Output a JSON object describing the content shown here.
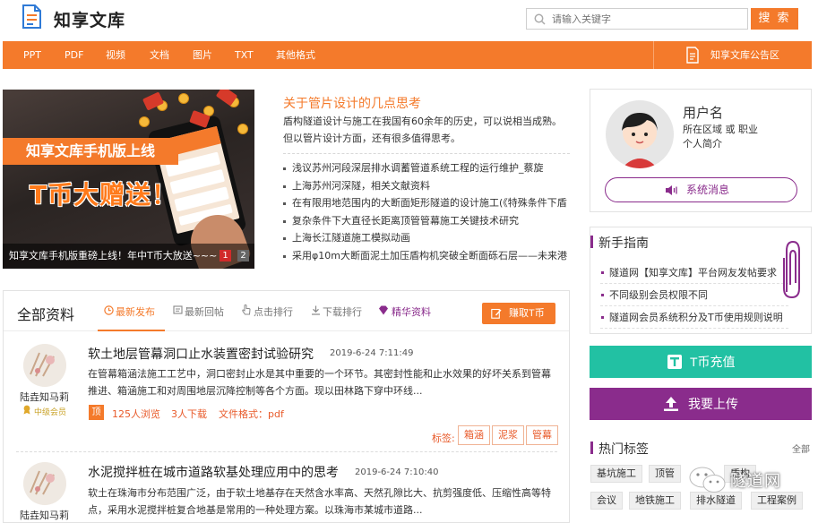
{
  "header": {
    "logo_text": "知享文库",
    "search_placeholder": "请输入关键字",
    "search_button": "搜 索"
  },
  "nav": {
    "items": [
      "PPT",
      "PDF",
      "视频",
      "文档",
      "图片",
      "TXT",
      "其他格式"
    ],
    "notice_label": "知享文库公告区"
  },
  "banner": {
    "headline": "知享文库手机版上线",
    "promo": "T币大赠送！",
    "caption": "知享文库手机版重磅上线！年中T币大放送~~~",
    "pages": [
      "1",
      "2"
    ],
    "active_page": "1"
  },
  "article": {
    "title": "关于管片设计的几点思考",
    "desc": "盾构隧道设计与施工在我国有60余年的历史，可以说相当成熟。但以管片设计方面，还有很多值得思考。",
    "links": [
      "浅议苏州河段深层排水调蓄管道系统工程的运行维护_蔡旋",
      "上海苏州河深隧，相关文献资料",
      "在有限用地范围内的大断面矩形隧道的设计施工(《特殊条件下盾",
      "复杂条件下大直径长距离顶管管幕施工关键技术研究",
      "上海长江隧道施工模拟动画",
      "采用φ10m大断面泥土加压盾构机突破全断面砾石层——未来港"
    ]
  },
  "profile": {
    "username": "用户名",
    "area": "所在区域 或 职业",
    "bio": "个人简介",
    "message_button": "系统消息"
  },
  "guide": {
    "title": "新手指南",
    "items": [
      "隧道网【知享文库】平台网友发帖要求",
      "不同级别会员权限不同",
      "隧道网会员系统积分及T币使用规则说明"
    ]
  },
  "actions": {
    "recharge": "T币充值",
    "upload": "我要上传"
  },
  "hot_tags": {
    "title": "热门标签",
    "all": "全部",
    "tags": [
      "基坑施工",
      "顶管",
      "盾构",
      "会议",
      "地铁施工",
      "排水隧道",
      "工程案例"
    ]
  },
  "resources": {
    "title": "全部资料",
    "tabs": [
      "最新发布",
      "最新回帖",
      "点击排行",
      "下载排行",
      "精华资料"
    ],
    "active_tab": "最新发布",
    "earn_button": "赚取T币",
    "items": [
      {
        "title": "软土地层管幕洞口止水装置密封试验研究",
        "date": "2019-6-24 7:11:49",
        "desc": "在管幕箱涵法施工工艺中，洞口密封止水是其中重要的一个环节。其密封性能和止水效果的好坏关系到管幕推进、箱涵施工和对周围地层沉降控制等各个方面。现以田林路下穿中环线...",
        "badge": "顶",
        "views": "125人浏览",
        "downloads": "3人下载",
        "format": "文件格式：pdf",
        "author": "陆垚知马莉",
        "level": "中级会员",
        "tags_label": "标签:",
        "tags": [
          "箱涵",
          "泥浆",
          "管幕"
        ]
      },
      {
        "title": "水泥搅拌桩在城市道路软基处理应用中的思考",
        "date": "2019-6-24 7:10:40",
        "desc": "软土在珠海市分布范围广泛，由于软土地基存在天然含水率高、天然孔隙比大、抗剪强度低、压缩性高等特点，采用水泥搅拌桩复合地基是常用的一种处理方案。以珠海市某城市道路...",
        "author": "陆垚知马莉"
      }
    ]
  },
  "watermark": "隧道网"
}
